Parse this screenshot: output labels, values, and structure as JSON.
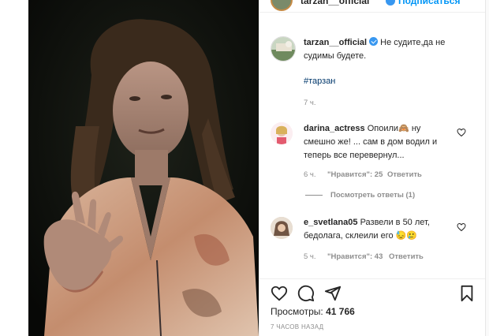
{
  "header": {
    "username": "tarzan__official",
    "follow_label": "Подписаться"
  },
  "caption": {
    "username": "tarzan__official",
    "text": "Не судите,да не судимы будете.",
    "hashtag": "#тарзан",
    "time": "7 ч."
  },
  "comments": [
    {
      "username": "darina_actress",
      "text": "Опоили🙈 ну смешно же! ... сам в дом водил и теперь все перевернул...",
      "time": "6 ч.",
      "likes": "\"Нравится\": 25",
      "reply": "Ответить",
      "view_replies": "Посмотреть ответы (1)"
    },
    {
      "username": "e_svetlana05",
      "text": "Развели в 50 лет, бедолага, склеили его 😓🥲",
      "time": "5 ч.",
      "likes": "\"Нравится\": 43",
      "reply": "Ответить"
    }
  ],
  "actions": {
    "views_label": "Просмотры:",
    "views_count": "41 766",
    "time_ago": "7 часов назад"
  },
  "colors": {
    "link": "#00376b",
    "follow": "#0095f6",
    "muted": "#8e8e8e",
    "verified": "#3897f0"
  },
  "icons": [
    "heart-icon",
    "comment-icon",
    "share-icon",
    "bookmark-icon",
    "verified-badge-icon"
  ]
}
